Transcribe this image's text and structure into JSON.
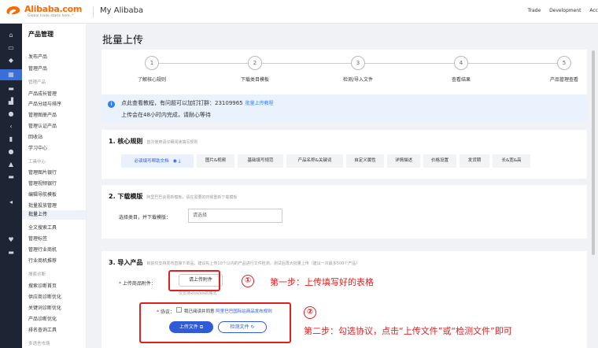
{
  "header": {
    "logo_text": "Alibaba.com",
    "logo_sub": "Global trade starts here.™",
    "app_title": "My Alibaba",
    "nav": [
      "Trade",
      "Development",
      "Acc"
    ]
  },
  "sidebar": {
    "title": "产品管理",
    "items": [
      {
        "label": "发布产品",
        "group": false
      },
      {
        "label": "管理产品",
        "group": false
      },
      {
        "label": "管理产品",
        "group": true
      },
      {
        "label": "产品成长管理",
        "group": false
      },
      {
        "label": "产品分组与排序",
        "group": false
      },
      {
        "label": "管理图册产品",
        "group": false
      },
      {
        "label": "管理认证产品",
        "group": false
      },
      {
        "label": "回收站",
        "group": false
      },
      {
        "label": "学习中心",
        "group": false
      },
      {
        "label": "工具中心",
        "group": true
      },
      {
        "label": "管理图片银行",
        "group": false
      },
      {
        "label": "管理视频银行",
        "group": false
      },
      {
        "label": "编辑导航模板",
        "group": false
      },
      {
        "label": "批量投放管理",
        "group": false
      },
      {
        "label": "批量上传",
        "group": false,
        "active": true
      },
      {
        "label": "全文搜索工具",
        "group": false
      },
      {
        "label": "管理标签",
        "group": false
      },
      {
        "label": "管理行业商机",
        "group": false
      },
      {
        "label": "行业商机推荐",
        "group": false
      },
      {
        "label": "搜索诊断",
        "group": true
      },
      {
        "label": "搜索诊断首页",
        "group": false
      },
      {
        "label": "供应商诊断优化",
        "group": false
      },
      {
        "label": "关键词诊断优化",
        "group": false
      },
      {
        "label": "产品诊断优化",
        "group": false
      },
      {
        "label": "排名查询工具",
        "group": false
      },
      {
        "label": "多语言市场",
        "group": true
      }
    ]
  },
  "page": {
    "title": "批量上传",
    "steps": [
      {
        "num": "1",
        "label": "了解核心规则"
      },
      {
        "num": "2",
        "label": "下载类目模板"
      },
      {
        "num": "3",
        "label": "检测/导入文件"
      },
      {
        "num": "4",
        "label": "查看结果"
      },
      {
        "num": "5",
        "label": "产品管理查看"
      }
    ],
    "notice": {
      "line1": "点此查看教程，有问题可以加钉钉群：23109965",
      "link": "批量上传教程",
      "line2": "上传会在48小时内完成，请耐心等待"
    }
  },
  "section1": {
    "title": "1. 核心规则",
    "desc": "首次使用请仔细阅读填写规则",
    "tabs": [
      "必读填写帮助文档",
      "图片&视频",
      "基础填写规范",
      "产品名称&关键词",
      "自定义属性",
      "详情描述",
      "价格设置",
      "发货期",
      "长&宽&高"
    ]
  },
  "section2": {
    "title": "2. 下载模版",
    "desc": "阿里巴巴会更新模板，请在需要的时候重新下载模板",
    "label": "选择类目，并下载模版：",
    "select_placeholder": "请选择"
  },
  "section3": {
    "title": "3. 导入产品",
    "desc": "目前仅支持发布直接下单品，建议先上传10个以内的产品进行文件检测，测试后再大批量上传（建议一次最多500个产品）",
    "attach_label": "上传商品附件：",
    "attach_button": "请上传附件",
    "attach_hint": "仅支持xlsx/xls的格式",
    "agree_label": "协议：",
    "agree_text": "我已阅读并同意",
    "agree_link": "阿里巴巴国际站商品发布规则",
    "upload_button": "上传文件",
    "check_button": "检测文件"
  },
  "annotations": {
    "num1": "①",
    "text1": "第一步：上传填写好的表格",
    "num2": "②",
    "text2": "第二步：勾选协议，点击“上传文件”或“检测文件”即可",
    "color": "#e02020"
  },
  "colors": {
    "accent": "#2f5bd8",
    "brand": "#ff6a00",
    "sidebar_dark": "#1d2433"
  }
}
